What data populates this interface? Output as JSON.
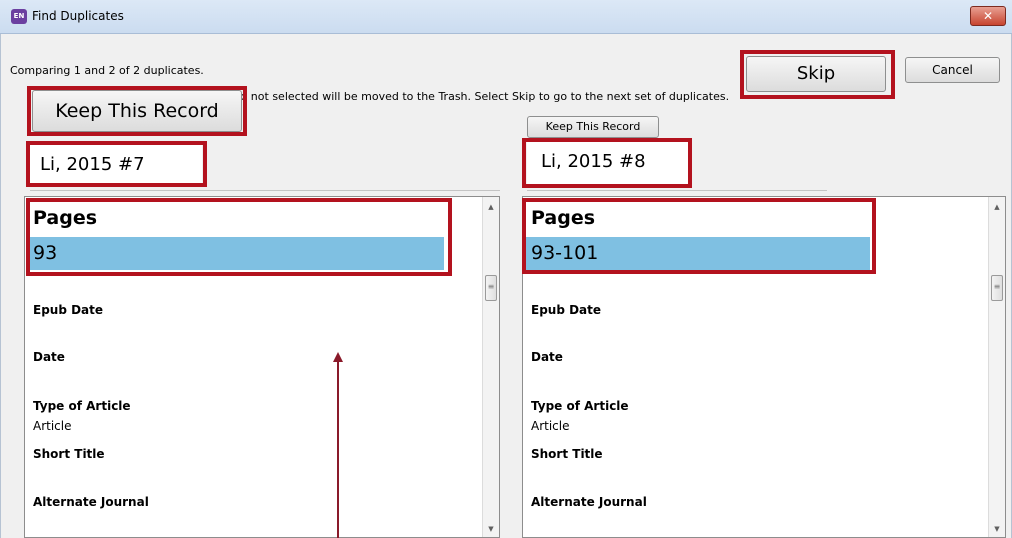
{
  "window": {
    "title": "Find Duplicates",
    "app_icon_text": "EN",
    "close_glyph": "✕"
  },
  "status": {
    "comparing_text": "Comparing 1 and 2 of 2 duplicates.",
    "instruction_text": "rd not selected will be moved to the Trash. Select Skip to go to the next set of duplicates."
  },
  "buttons": {
    "skip_label": "Skip",
    "cancel_label": "Cancel",
    "keep_left_label": "Keep This Record",
    "keep_right_label": "Keep This Record"
  },
  "records": {
    "left": {
      "label": "Li, 2015 #7",
      "fields": [
        {
          "header": "Pages",
          "value": "93"
        },
        {
          "header": "Epub Date",
          "value": ""
        },
        {
          "header": "Date",
          "value": ""
        },
        {
          "header": "Type of Article",
          "value": "Article"
        },
        {
          "header": "Short Title",
          "value": ""
        },
        {
          "header": "Alternate Journal",
          "value": ""
        }
      ]
    },
    "right": {
      "label": "Li, 2015 #8",
      "fields": [
        {
          "header": "Pages",
          "value": "93-101"
        },
        {
          "header": "Epub Date",
          "value": ""
        },
        {
          "header": "Date",
          "value": ""
        },
        {
          "header": "Type of Article",
          "value": "Article"
        },
        {
          "header": "Short Title",
          "value": ""
        },
        {
          "header": "Alternate Journal",
          "value": ""
        }
      ]
    }
  },
  "icons": {
    "scroll_up": "▲",
    "scroll_down": "▼",
    "scroll_grip": "≡"
  },
  "colors": {
    "highlight": "#b3121e",
    "selected_row": "#7fc0e2",
    "arrow": "#8a1a2a"
  }
}
